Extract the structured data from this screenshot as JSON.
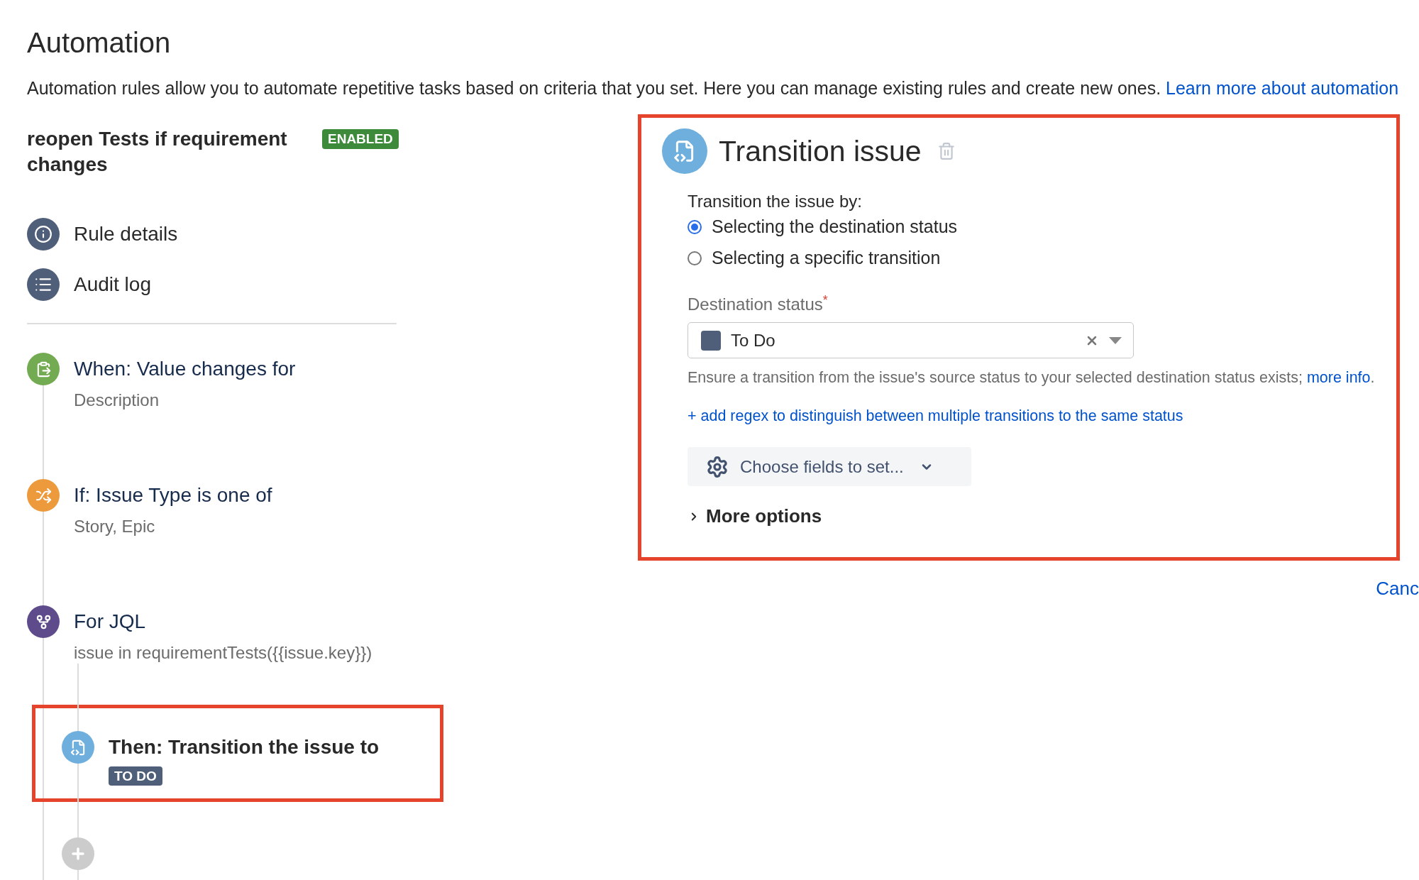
{
  "page": {
    "title": "Automation",
    "description": "Automation rules allow you to automate repetitive tasks based on criteria that you set. Here you can manage existing rules and create new ones.",
    "learn_more_link": "Learn more about automation"
  },
  "rule": {
    "name": "reopen Tests if requirement changes",
    "status_badge": "ENABLED"
  },
  "nav_items": [
    {
      "kind": "info",
      "label": "Rule details"
    },
    {
      "kind": "log",
      "label": "Audit log"
    }
  ],
  "steps": [
    {
      "kind": "trigger",
      "title": "When: Value changes for",
      "detail": "Description"
    },
    {
      "kind": "condition",
      "title": "If: Issue Type is one of",
      "detail": "Story, Epic"
    },
    {
      "kind": "branch",
      "title": "For JQL",
      "detail": "issue in requirementTests({{issue.key}})",
      "children": [
        {
          "kind": "action",
          "title": "Then: Transition the issue to",
          "badge": "TO DO",
          "selected": true
        }
      ]
    }
  ],
  "editor": {
    "kind": "action",
    "title": "Transition issue",
    "prompt": "Transition the issue by:",
    "radio_options": [
      {
        "label": "Selecting the destination status",
        "selected": true
      },
      {
        "label": "Selecting a specific transition",
        "selected": false
      }
    ],
    "destination_status": {
      "label": "Destination status",
      "required_mark": "*",
      "value": "To Do",
      "color": "#505f79"
    },
    "help_text": "Ensure a transition from the issue's source status to your selected destination status exists;",
    "help_link": "more info",
    "help_end": ".",
    "regex_link": "+ add regex to distinguish between multiple transitions to the same status",
    "fields_button": "Choose fields to set...",
    "more_options": {
      "label": "More options",
      "expanded": false
    }
  },
  "cancel_link": "Canc"
}
